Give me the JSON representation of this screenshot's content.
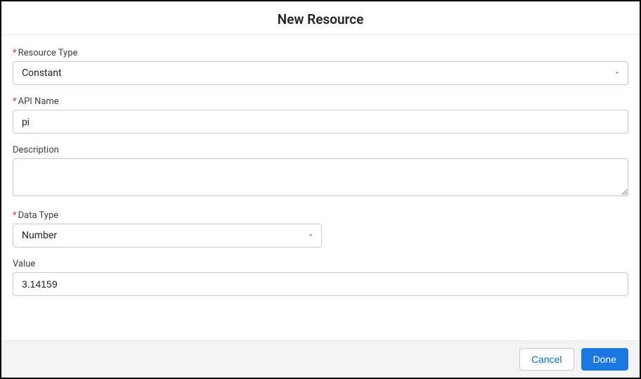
{
  "header": {
    "title": "New Resource"
  },
  "fields": {
    "resourceType": {
      "label": "Resource Type",
      "value": "Constant"
    },
    "apiName": {
      "label": "API Name",
      "value": "pi"
    },
    "description": {
      "label": "Description",
      "value": ""
    },
    "dataType": {
      "label": "Data Type",
      "value": "Number"
    },
    "value": {
      "label": "Value",
      "value": "3.14159"
    }
  },
  "footer": {
    "cancel": "Cancel",
    "done": "Done"
  }
}
